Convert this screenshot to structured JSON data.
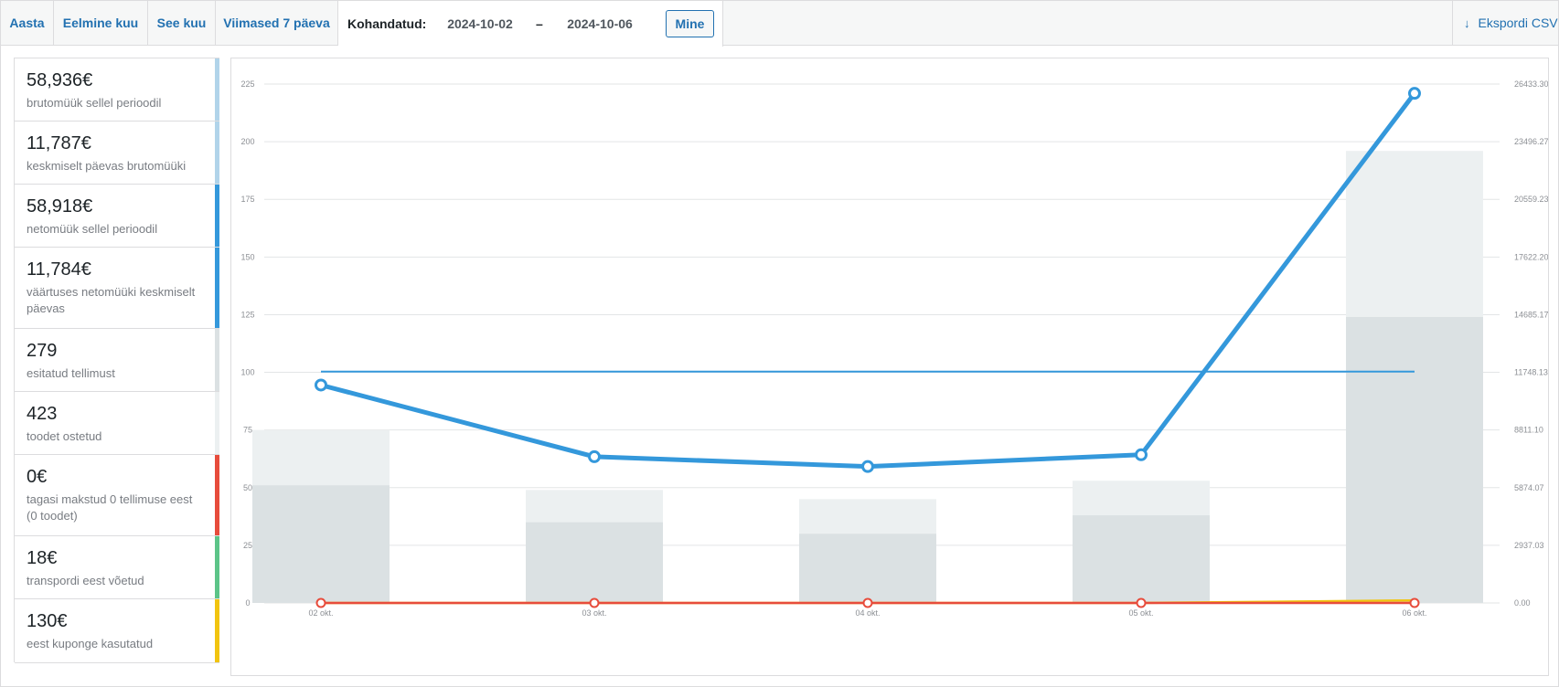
{
  "topbar": {
    "tabs": [
      {
        "label": "Aasta"
      },
      {
        "label": "Eelmine kuu"
      },
      {
        "label": "See kuu"
      },
      {
        "label": "Viimased 7 päeva"
      }
    ],
    "custom_label": "Kohandatud:",
    "start_date": "2024-10-02",
    "dash": "–",
    "end_date": "2024-10-06",
    "go_label": "Mine",
    "export_label": "Ekspordi CSV",
    "export_icon": "download-arrow-icon"
  },
  "legend": [
    {
      "value": "58,936€",
      "desc": "brutomüük sellel perioodil",
      "color": "#b1d4ea"
    },
    {
      "value": "11,787€",
      "desc": "keskmiselt päevas brutomüüki",
      "color": "#b1d4ea"
    },
    {
      "value": "58,918€",
      "desc": "netomüük sellel perioodil",
      "color": "#3498db"
    },
    {
      "value": "11,784€",
      "desc": "väärtuses netomüüki keskmiselt päevas",
      "color": "#3498db"
    },
    {
      "value": "279",
      "desc": "esitatud tellimust",
      "color": "#dbe1e3"
    },
    {
      "value": "423",
      "desc": "toodet ostetud",
      "color": "#ecf0f1"
    },
    {
      "value": "0€",
      "desc": "tagasi makstud 0 tellimuse eest (0 toodet)",
      "color": "#e74c3c"
    },
    {
      "value": "18€",
      "desc": "transpordi eest võetud",
      "color": "#5cc488"
    },
    {
      "value": "130€",
      "desc": "eest kuponge kasutatud",
      "color": "#f1c40f"
    }
  ],
  "chart_data": {
    "type": "bar",
    "categories": [
      "02 okt.",
      "03 okt.",
      "04 okt.",
      "05 okt.",
      "06 okt."
    ],
    "y_left": {
      "ticks": [
        "0",
        "25",
        "50",
        "75",
        "100",
        "125",
        "150",
        "175",
        "200",
        "225"
      ],
      "ylim": [
        0,
        225
      ]
    },
    "y_right": {
      "ticks": [
        "0.00",
        "2937.03",
        "5874.07",
        "8811.10",
        "11748.13",
        "14685.17",
        "17622.20",
        "20559.23",
        "23496.27",
        "26433.30"
      ],
      "ylim": [
        0,
        26433.3
      ]
    },
    "series": [
      {
        "values": [
          75,
          49,
          45,
          53,
          196
        ],
        "axis": "left",
        "kind": "bar",
        "color": "#ecf0f1"
      },
      {
        "values": [
          51,
          35,
          30,
          38,
          124
        ],
        "axis": "left",
        "kind": "bar",
        "color": "#dbe1e3"
      },
      {
        "values": [
          11100,
          7450,
          6950,
          7550,
          25960
        ],
        "axis": "right",
        "kind": "line",
        "color": "#3498db"
      },
      {
        "values": [
          11784,
          11784,
          11784,
          11784,
          11784
        ],
        "axis": "right",
        "kind": "flatline",
        "color": "#3498db"
      },
      {
        "values": [
          0,
          0,
          0,
          0,
          0
        ],
        "axis": "right",
        "kind": "line",
        "color": "#e74c3c"
      },
      {
        "values": [
          0,
          0,
          0,
          0,
          130
        ],
        "axis": "right",
        "kind": "line",
        "color": "#f1c40f"
      }
    ],
    "grid": true
  }
}
